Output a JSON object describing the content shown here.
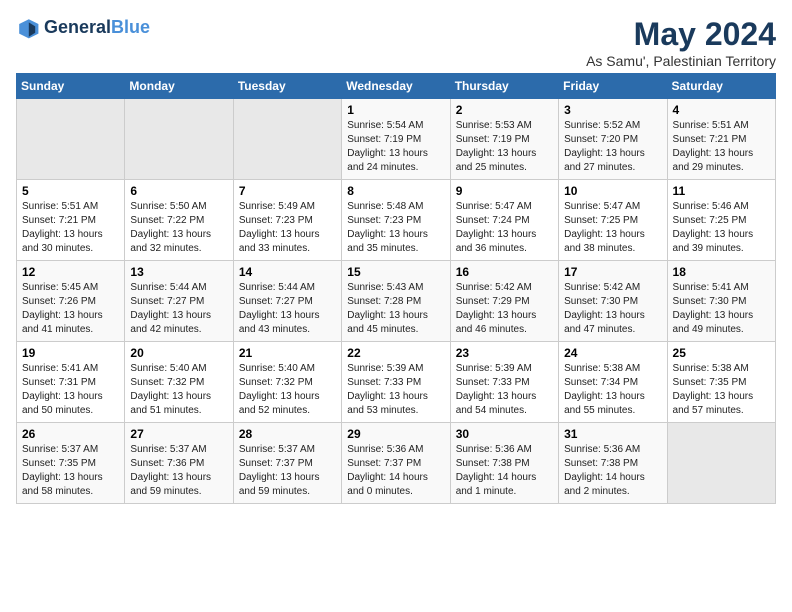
{
  "logo": {
    "line1": "General",
    "line2": "Blue"
  },
  "title": "May 2024",
  "subtitle": "As Samu', Palestinian Territory",
  "days_header": [
    "Sunday",
    "Monday",
    "Tuesday",
    "Wednesday",
    "Thursday",
    "Friday",
    "Saturday"
  ],
  "weeks": [
    [
      {
        "day": "",
        "info": ""
      },
      {
        "day": "",
        "info": ""
      },
      {
        "day": "",
        "info": ""
      },
      {
        "day": "1",
        "info": "Sunrise: 5:54 AM\nSunset: 7:19 PM\nDaylight: 13 hours\nand 24 minutes."
      },
      {
        "day": "2",
        "info": "Sunrise: 5:53 AM\nSunset: 7:19 PM\nDaylight: 13 hours\nand 25 minutes."
      },
      {
        "day": "3",
        "info": "Sunrise: 5:52 AM\nSunset: 7:20 PM\nDaylight: 13 hours\nand 27 minutes."
      },
      {
        "day": "4",
        "info": "Sunrise: 5:51 AM\nSunset: 7:21 PM\nDaylight: 13 hours\nand 29 minutes."
      }
    ],
    [
      {
        "day": "5",
        "info": "Sunrise: 5:51 AM\nSunset: 7:21 PM\nDaylight: 13 hours\nand 30 minutes."
      },
      {
        "day": "6",
        "info": "Sunrise: 5:50 AM\nSunset: 7:22 PM\nDaylight: 13 hours\nand 32 minutes."
      },
      {
        "day": "7",
        "info": "Sunrise: 5:49 AM\nSunset: 7:23 PM\nDaylight: 13 hours\nand 33 minutes."
      },
      {
        "day": "8",
        "info": "Sunrise: 5:48 AM\nSunset: 7:23 PM\nDaylight: 13 hours\nand 35 minutes."
      },
      {
        "day": "9",
        "info": "Sunrise: 5:47 AM\nSunset: 7:24 PM\nDaylight: 13 hours\nand 36 minutes."
      },
      {
        "day": "10",
        "info": "Sunrise: 5:47 AM\nSunset: 7:25 PM\nDaylight: 13 hours\nand 38 minutes."
      },
      {
        "day": "11",
        "info": "Sunrise: 5:46 AM\nSunset: 7:25 PM\nDaylight: 13 hours\nand 39 minutes."
      }
    ],
    [
      {
        "day": "12",
        "info": "Sunrise: 5:45 AM\nSunset: 7:26 PM\nDaylight: 13 hours\nand 41 minutes."
      },
      {
        "day": "13",
        "info": "Sunrise: 5:44 AM\nSunset: 7:27 PM\nDaylight: 13 hours\nand 42 minutes."
      },
      {
        "day": "14",
        "info": "Sunrise: 5:44 AM\nSunset: 7:27 PM\nDaylight: 13 hours\nand 43 minutes."
      },
      {
        "day": "15",
        "info": "Sunrise: 5:43 AM\nSunset: 7:28 PM\nDaylight: 13 hours\nand 45 minutes."
      },
      {
        "day": "16",
        "info": "Sunrise: 5:42 AM\nSunset: 7:29 PM\nDaylight: 13 hours\nand 46 minutes."
      },
      {
        "day": "17",
        "info": "Sunrise: 5:42 AM\nSunset: 7:30 PM\nDaylight: 13 hours\nand 47 minutes."
      },
      {
        "day": "18",
        "info": "Sunrise: 5:41 AM\nSunset: 7:30 PM\nDaylight: 13 hours\nand 49 minutes."
      }
    ],
    [
      {
        "day": "19",
        "info": "Sunrise: 5:41 AM\nSunset: 7:31 PM\nDaylight: 13 hours\nand 50 minutes."
      },
      {
        "day": "20",
        "info": "Sunrise: 5:40 AM\nSunset: 7:32 PM\nDaylight: 13 hours\nand 51 minutes."
      },
      {
        "day": "21",
        "info": "Sunrise: 5:40 AM\nSunset: 7:32 PM\nDaylight: 13 hours\nand 52 minutes."
      },
      {
        "day": "22",
        "info": "Sunrise: 5:39 AM\nSunset: 7:33 PM\nDaylight: 13 hours\nand 53 minutes."
      },
      {
        "day": "23",
        "info": "Sunrise: 5:39 AM\nSunset: 7:33 PM\nDaylight: 13 hours\nand 54 minutes."
      },
      {
        "day": "24",
        "info": "Sunrise: 5:38 AM\nSunset: 7:34 PM\nDaylight: 13 hours\nand 55 minutes."
      },
      {
        "day": "25",
        "info": "Sunrise: 5:38 AM\nSunset: 7:35 PM\nDaylight: 13 hours\nand 57 minutes."
      }
    ],
    [
      {
        "day": "26",
        "info": "Sunrise: 5:37 AM\nSunset: 7:35 PM\nDaylight: 13 hours\nand 58 minutes."
      },
      {
        "day": "27",
        "info": "Sunrise: 5:37 AM\nSunset: 7:36 PM\nDaylight: 13 hours\nand 59 minutes."
      },
      {
        "day": "28",
        "info": "Sunrise: 5:37 AM\nSunset: 7:37 PM\nDaylight: 13 hours\nand 59 minutes."
      },
      {
        "day": "29",
        "info": "Sunrise: 5:36 AM\nSunset: 7:37 PM\nDaylight: 14 hours\nand 0 minutes."
      },
      {
        "day": "30",
        "info": "Sunrise: 5:36 AM\nSunset: 7:38 PM\nDaylight: 14 hours\nand 1 minute."
      },
      {
        "day": "31",
        "info": "Sunrise: 5:36 AM\nSunset: 7:38 PM\nDaylight: 14 hours\nand 2 minutes."
      },
      {
        "day": "",
        "info": ""
      }
    ]
  ]
}
